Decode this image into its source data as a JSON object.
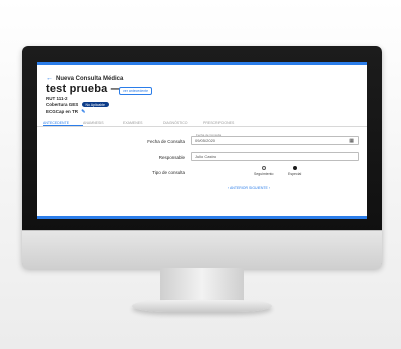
{
  "header": {
    "back_label": "Nueva Consulta Médica",
    "patient_name": "test prueba ——",
    "patient_button": "ver antecedente",
    "rut": "RUT 111-2",
    "coverage_label": "Cobertura GES",
    "coverage_badge": "No Aplicable",
    "ecg_label": "ECGCap en TR"
  },
  "tabs": [
    {
      "label": "ANTECEDENTE"
    },
    {
      "label": "ANAMNESIS"
    },
    {
      "label": "EXAMENES"
    },
    {
      "label": "DIAGNÓSTICO"
    },
    {
      "label": "PRESCRIPCIONES"
    }
  ],
  "form": {
    "date_label": "Fecha de Consulta",
    "date_float_label": "Fecha de Consulta",
    "date_value": "09/05/2020",
    "responsible_label": "Responsable",
    "responsible_value": "Julio Castro",
    "type_label": "Tipo de consulta",
    "type_options": [
      "Seguimiento",
      "Especial"
    ],
    "selected_type": "Especial",
    "next_label": "ANTERIOR   SIGUIENTE"
  },
  "icons": {
    "back": "arrow-left-icon",
    "edit": "pencil-icon",
    "calendar": "calendar-icon"
  },
  "colors": {
    "accent": "#2b7de9",
    "badge": "#0d3d8a"
  }
}
